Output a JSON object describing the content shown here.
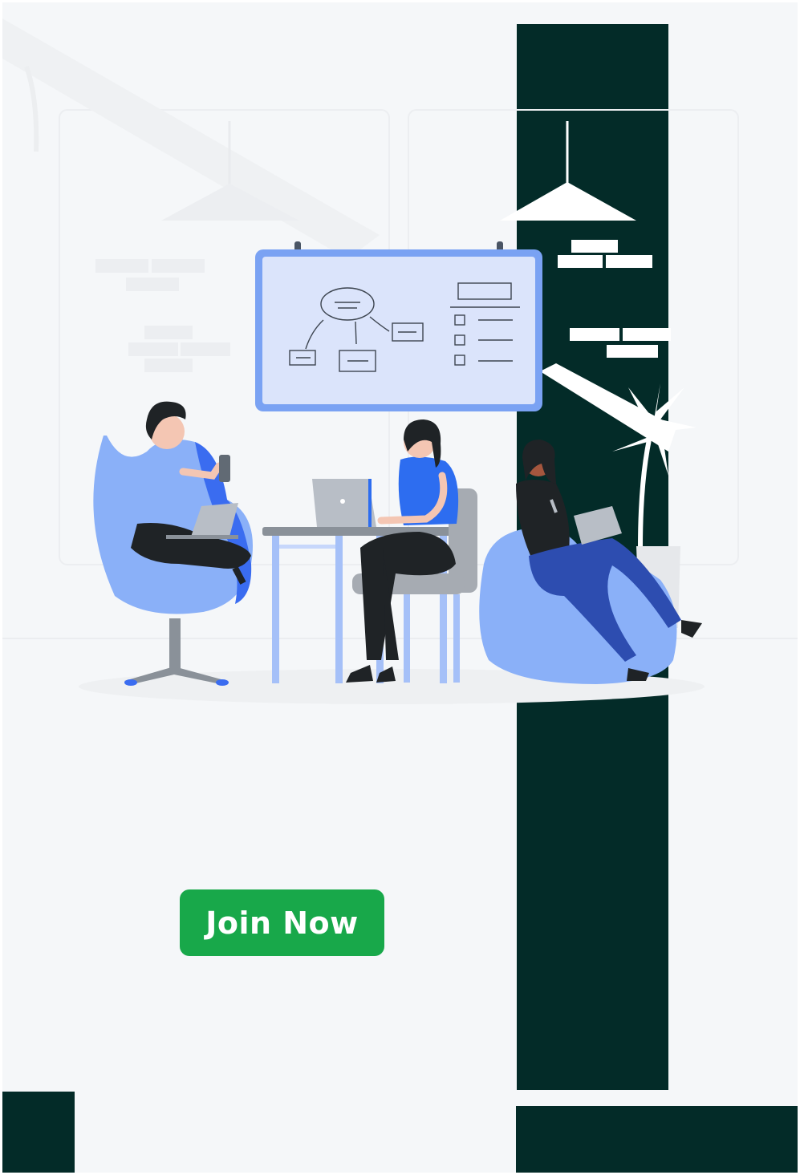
{
  "cta": {
    "join_label": "Join Now"
  },
  "colors": {
    "accent": "#18a84a",
    "dark": "#032b28",
    "background": "#f5f7f9",
    "illustration_blue": "#3a6cf0"
  },
  "illustration": {
    "icon": "team-working-illustration"
  }
}
